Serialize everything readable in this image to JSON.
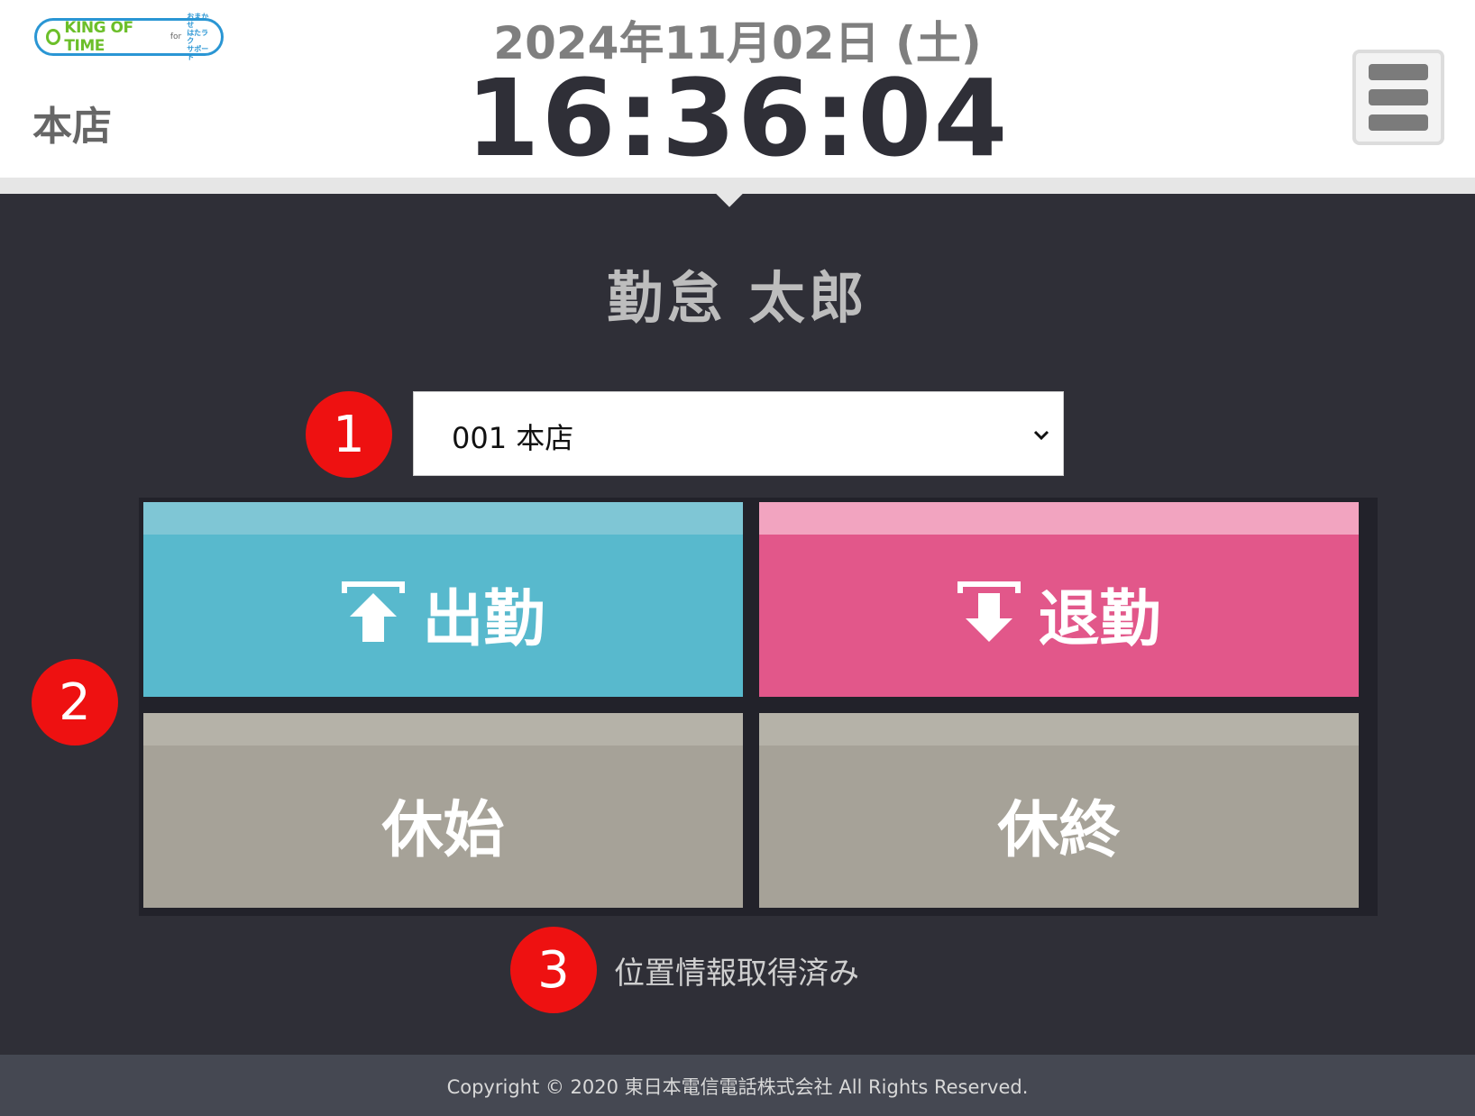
{
  "header": {
    "logo": {
      "text": "KING OF TIME",
      "for_label": "for",
      "sub_line1": "おまかせ",
      "sub_line2": "はたラク",
      "sub_line3": "サポート"
    },
    "store_name": "本店",
    "date": "2024年11月02日 (土)",
    "time": "16:36:04",
    "menu_icon": "hamburger-menu-icon"
  },
  "employee_name": "勤怠 太郎",
  "store_select": {
    "selected": "001 本店"
  },
  "buttons": {
    "clock_in": "出勤",
    "clock_out": "退勤",
    "break_start": "休始",
    "break_end": "休終"
  },
  "badges": [
    "1",
    "2",
    "3"
  ],
  "location_status": "位置情報取得済み",
  "footer": {
    "copyright": "Copyright © 2020 東日本電信電話株式会社 All Rights Reserved."
  },
  "colors": {
    "clock_in": "#58b9cd",
    "clock_out": "#e2578a",
    "break": "#a6a298",
    "background": "#2f2f37",
    "badge": "#ee1111"
  }
}
